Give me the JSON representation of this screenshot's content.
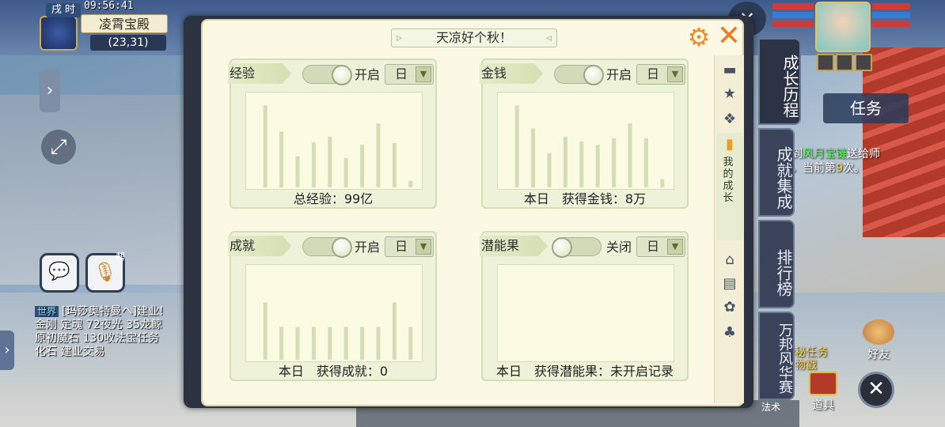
{
  "hud": {
    "time_tag": "戌 时",
    "clock": "09:56:41",
    "location_name": "凌霄宝殿",
    "coordinates": "(23,31)",
    "voice_tag": "帮",
    "chat": {
      "channel": "世界",
      "lines": [
        "[玛莎奥特曼ヘ]建业!",
        "金刚 定魂 72夜光 35龙鲸",
        "原初魔石 130收法宝任务",
        "化石 建业交易"
      ]
    },
    "task_tab": "任务",
    "quest_text": {
      "prefix": "到",
      "highlight": "风月宝链",
      "suffix": "送给师",
      "line2a": "，当前第",
      "line2num": "9",
      "line2b": "次。"
    },
    "friend_label": "好友",
    "item_label": "道具",
    "quest_gift": "神秘任务\n物戳",
    "bottom_label": "法术"
  },
  "panel": {
    "title": "天凉好个秋！",
    "side_tabs": {
      "active_label": "我的成长"
    }
  },
  "cards": [
    {
      "key": "exp",
      "name": "经验",
      "toggle_text": "开启",
      "toggle_on": true,
      "period": "日",
      "summary": "总经验：99亿",
      "chart_data": {
        "type": "bar",
        "values": [
          100,
          68,
          38,
          55,
          62,
          36,
          52,
          78,
          54,
          8
        ],
        "ylim": [
          0,
          110
        ]
      }
    },
    {
      "key": "money",
      "name": "金钱",
      "toggle_text": "开启",
      "toggle_on": true,
      "period": "日",
      "summary": "本日　获得金钱：8万",
      "chart_data": {
        "type": "bar",
        "values": [
          100,
          72,
          42,
          62,
          56,
          52,
          60,
          78,
          60,
          10
        ],
        "ylim": [
          0,
          110
        ]
      }
    },
    {
      "key": "achievement",
      "name": "成就",
      "toggle_text": "开启",
      "toggle_on": true,
      "period": "日",
      "summary": "本日　获得成就：0",
      "chart_data": {
        "type": "bar",
        "values": [
          70,
          40,
          40,
          40,
          40,
          40,
          40,
          40,
          70,
          40
        ],
        "ylim": [
          0,
          110
        ]
      }
    },
    {
      "key": "potential",
      "name": "潜能果",
      "toggle_text": "关闭",
      "toggle_on": false,
      "period": "日",
      "summary": "本日　获得潜能果：未开启记录",
      "chart_data": {
        "type": "bar",
        "values": [],
        "ylim": [
          0,
          110
        ]
      }
    }
  ],
  "right_tabs": [
    "成长历程",
    "成就集成",
    "排行榜",
    "万邦风华赛"
  ]
}
